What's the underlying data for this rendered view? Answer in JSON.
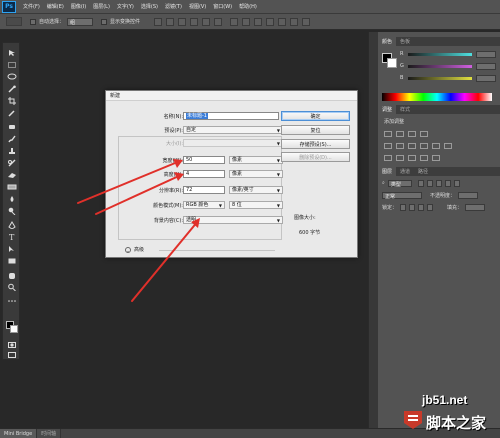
{
  "app": {
    "logo": "Ps"
  },
  "menu": [
    "文件(F)",
    "编辑(E)",
    "图像(I)",
    "图层(L)",
    "文字(Y)",
    "选择(S)",
    "滤镜(T)",
    "视图(V)",
    "窗口(W)",
    "帮助(H)"
  ],
  "options": {
    "auto_select": "自动选择：",
    "auto_select_value": "组",
    "show_transform": "显示变换控件"
  },
  "status_tabs": [
    "Mini Bridge",
    "时间轴"
  ],
  "panels": {
    "color_tabs": [
      "颜色",
      "色板"
    ],
    "sliders": [
      {
        "letter": "R",
        "color": "#4ee0e0"
      },
      {
        "letter": "G",
        "color": "#d060e0"
      },
      {
        "letter": "B",
        "color": "#e0e040"
      }
    ],
    "adjust_tabs": [
      "调整",
      "样式"
    ],
    "adjust_title": "添加调整",
    "layers_tabs": [
      "图层",
      "通道",
      "路径"
    ],
    "layers_kind": "类型",
    "layers_mode": "正常",
    "layers_opacity": "不透明度：",
    "layers_lock": "锁定：",
    "layers_fill": "填充："
  },
  "dialog": {
    "title": "新建",
    "fields": {
      "name": {
        "label": "名称(N):",
        "value": "未标题-1"
      },
      "preset": {
        "label": "预设(P):",
        "value": "自定"
      },
      "size": {
        "label": "大小(I):",
        "value": ""
      },
      "width": {
        "label": "宽度(W):",
        "value": "50",
        "unit": "像素"
      },
      "height": {
        "label": "高度(H):",
        "value": "4",
        "unit": "像素"
      },
      "resolution": {
        "label": "分辨率(R):",
        "value": "72",
        "unit": "像素/英寸"
      },
      "color_mode": {
        "label": "颜色模式(M):",
        "value": "RGB 颜色",
        "depth": "8 位"
      },
      "background": {
        "label": "背景内容(C):",
        "value": "透明"
      }
    },
    "advanced": "高级",
    "buttons": {
      "ok": "确定",
      "reset": "复位",
      "save_preset": "存储预设(S)...",
      "delete_preset": "删除预设(D)..."
    },
    "image_size_label": "图像大小:",
    "image_size_value": "600 字节"
  },
  "watermark": {
    "site": "jb51.net",
    "name": "脚本之家"
  }
}
